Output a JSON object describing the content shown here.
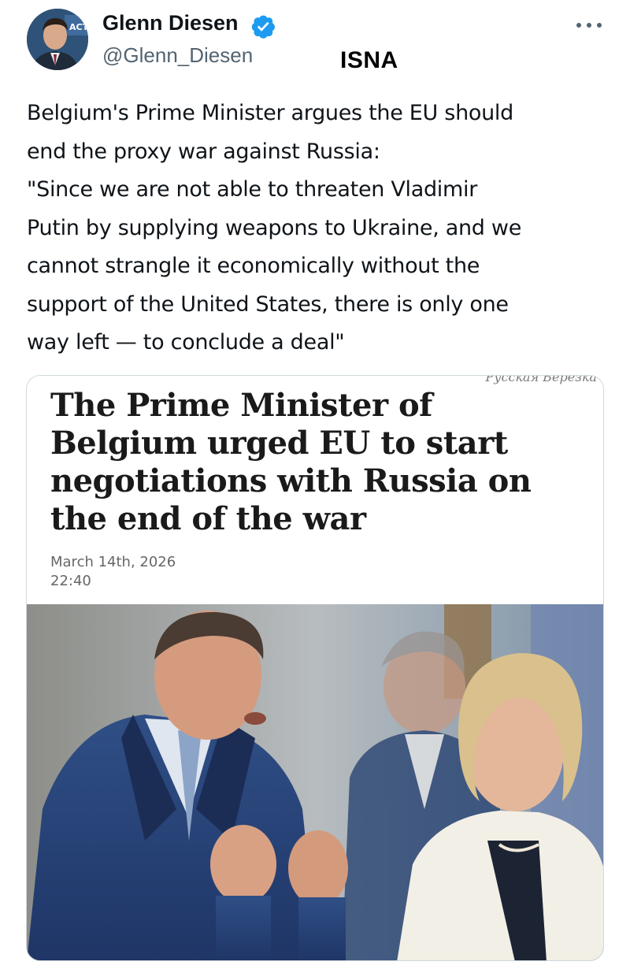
{
  "author": {
    "name": "Glenn Diesen",
    "handle": "@Glenn_Diesen",
    "verified": true,
    "avatar_icon": "profile-photo"
  },
  "watermark": "ISNA",
  "more_icon": "more-options-icon",
  "tweet": {
    "lines": [
      "Belgium's Prime Minister argues the EU should",
      "end the proxy war against Russia:",
      "\"Since we are not able to threaten Vladimir",
      "Putin by supplying weapons to Ukraine, and we",
      "cannot strangle it economically without the",
      "support of the United States, there is only one",
      "way left — to conclude a deal\""
    ]
  },
  "card": {
    "source": "Русская Березка",
    "headline_lines": [
      "The Prime Minister of",
      "Belgium urged EU to start",
      "negotiations with Russia on",
      "the end of the war"
    ],
    "date": "March 14th, 2026",
    "time": "22:40"
  },
  "colors": {
    "text": "#0f1419",
    "secondary": "#536471",
    "verified": "#1d9bf0",
    "border": "#cfd9de"
  }
}
